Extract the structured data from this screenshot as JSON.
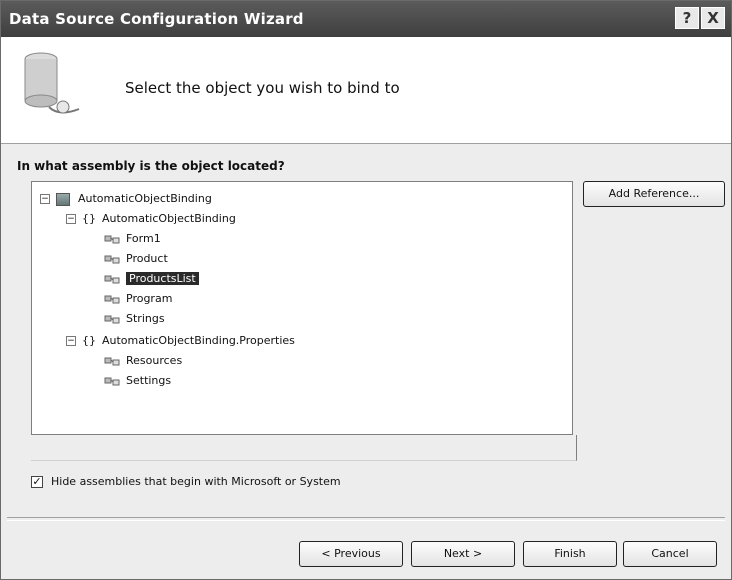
{
  "window": {
    "title": "Data Source Configuration Wizard",
    "help_label": "?",
    "close_label": "X"
  },
  "header": {
    "text": "Select the object you wish to bind to"
  },
  "question": "In what assembly is the object located?",
  "tree": {
    "assembly": "AutomaticObjectBinding",
    "namespace1": "AutomaticObjectBinding",
    "classes1": [
      "Form1",
      "Product",
      "ProductsList",
      "Program",
      "Strings"
    ],
    "namespace2": "AutomaticObjectBinding.Properties",
    "classes2": [
      "Resources",
      "Settings"
    ]
  },
  "buttons": {
    "add_reference": "Add Reference...",
    "previous": "< Previous",
    "next": "Next >",
    "finish": "Finish",
    "cancel": "Cancel"
  },
  "hide_checkbox": {
    "label": "Hide assemblies that begin with Microsoft or System",
    "checked": true
  }
}
